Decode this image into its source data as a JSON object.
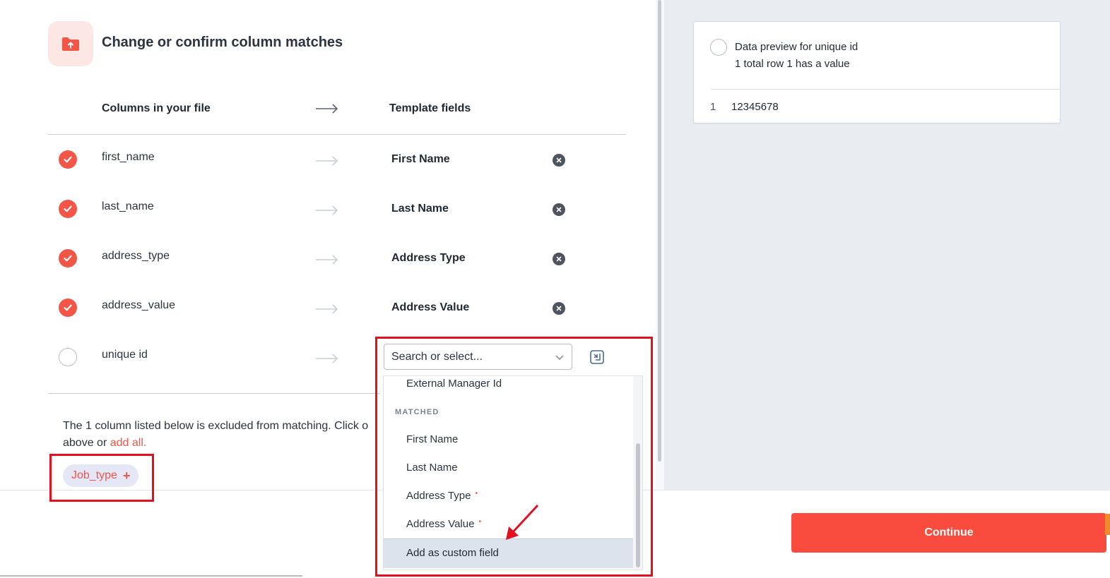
{
  "page": {
    "title": "Change or confirm column matches",
    "header_icon": "folder-upload-icon"
  },
  "mapping": {
    "columns_header": "Columns in your file",
    "fields_header": "Template fields",
    "rows": [
      {
        "column": "first_name",
        "field": "First Name",
        "matched": true
      },
      {
        "column": "last_name",
        "field": "Last Name",
        "matched": true
      },
      {
        "column": "address_type",
        "field": "Address Type",
        "matched": true
      },
      {
        "column": "address_value",
        "field": "Address Value",
        "matched": true
      },
      {
        "column": "unique id",
        "field": "",
        "matched": false
      }
    ]
  },
  "select": {
    "placeholder": "Search or select...",
    "dropdown": {
      "top_item": "External Manager Id",
      "group_label": "MATCHED",
      "items": [
        {
          "label": "First Name",
          "required": false
        },
        {
          "label": "Last Name",
          "required": false
        },
        {
          "label": "Address Type",
          "required": true
        },
        {
          "label": "Address Value",
          "required": true
        }
      ],
      "required_marker": "•",
      "custom_field_label": "Add as custom field"
    }
  },
  "excluded": {
    "text_before": "The 1 column listed below is excluded from matching. Click o",
    "text_line2": "above or ",
    "add_all_link": "add all.",
    "chips": [
      {
        "label": "Job_type",
        "icon": "+"
      }
    ]
  },
  "preview": {
    "title": "Data preview for unique id",
    "subtitle": "1 total row 1 has a value",
    "rows": [
      {
        "index": "1",
        "value": "12345678"
      }
    ]
  },
  "footer": {
    "continue_label": "Continue"
  },
  "colors": {
    "accent": "#f94c3f",
    "check": "#f35647",
    "annotation": "#e3101f"
  }
}
